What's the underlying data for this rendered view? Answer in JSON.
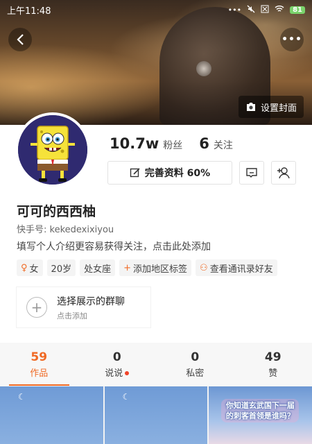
{
  "status_bar": {
    "time": "上午11:48",
    "battery": "81"
  },
  "cover": {
    "set_cover_label": "设置封面"
  },
  "stats": [
    {
      "value": "10.7w",
      "label": "粉丝"
    },
    {
      "value": "6",
      "label": "关注"
    }
  ],
  "actions": {
    "complete_profile_label": "完善资料 60%"
  },
  "profile": {
    "name": "可可的西西柚",
    "kuaishou_id": "快手号: kekedexixiyou",
    "bio_prompt": "填写个人介绍更容易获得关注，点击此处添加"
  },
  "tags": [
    {
      "icon": "female-icon",
      "label": "女"
    },
    {
      "icon": "",
      "label": "20岁"
    },
    {
      "icon": "",
      "label": "处女座"
    },
    {
      "icon": "plus-icon",
      "label": "添加地区标签"
    },
    {
      "icon": "contacts-icon",
      "label": "查看通讯录好友"
    }
  ],
  "group": {
    "title": "选择展示的群聊",
    "subtitle": "点击添加"
  },
  "tabs": [
    {
      "count": "59",
      "label": "作品",
      "active": true
    },
    {
      "count": "0",
      "label": "说说",
      "dot": true
    },
    {
      "count": "0",
      "label": "私密"
    },
    {
      "count": "49",
      "label": "赞"
    }
  ],
  "grid": {
    "thumb3_caption": "你知道玄武国下一届的刺客首领是谁吗？"
  },
  "colors": {
    "accent": "#f06a25",
    "avatar_bg": "#2f2a70"
  }
}
